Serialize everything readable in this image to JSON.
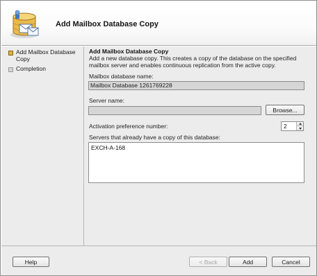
{
  "wizard": {
    "title": "Add Mailbox Database Copy"
  },
  "nav": {
    "items": [
      {
        "label": "Add Mailbox Database Copy",
        "state": "active"
      },
      {
        "label": "Completion",
        "state": "pending"
      }
    ]
  },
  "page": {
    "heading": "Add Mailbox Database Copy",
    "description": "Add a new database copy. This creates a copy of the database on the specified mailbox server and enables continuous replication from the active copy.",
    "db_name_label": "Mailbox database name:",
    "db_name_value": "Mailbox Database 1261769228",
    "server_name_label": "Server name:",
    "server_name_value": "",
    "browse_label": "Browse...",
    "activation_label": "Activation preference number:",
    "activation_value": "2",
    "servers_label": "Servers that already have a copy of this database:",
    "servers": [
      "EXCH-A-168"
    ]
  },
  "footer": {
    "help_label": "Help",
    "back_label": "< Back",
    "add_label": "Add",
    "cancel_label": "Cancel"
  },
  "colors": {
    "active_marker": "#dcb33a",
    "pending_marker": "#d4d4d4",
    "panel_bg": "#ececec"
  },
  "icons": {
    "header": "mailbox-database-icon",
    "spinner_up": "triangle-up-icon",
    "spinner_down": "triangle-down-icon"
  }
}
